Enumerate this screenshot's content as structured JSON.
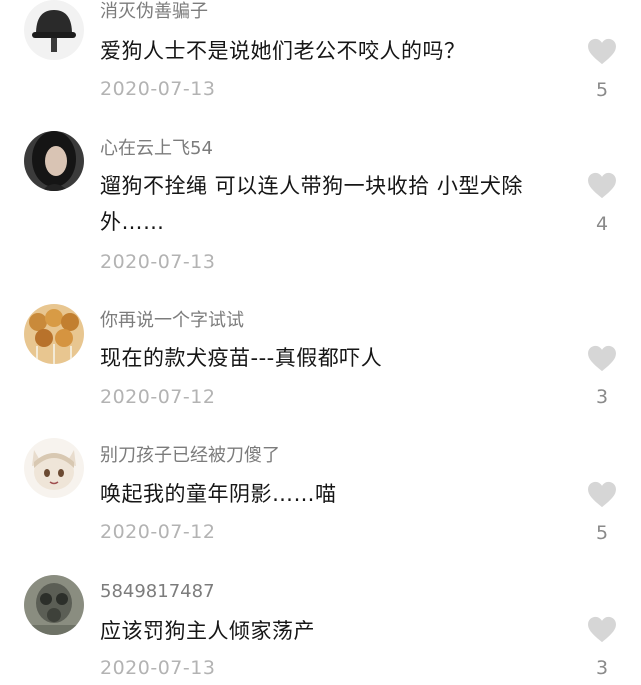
{
  "comments": [
    {
      "username": "消灭伪善骗子",
      "avatar_icon": "helmet-avatar",
      "text": "爱狗人士不是说她们老公不咬人的吗？",
      "date": "2020-07-13",
      "likes": "5"
    },
    {
      "username": "心在云上飞54",
      "avatar_icon": "dark-hair-avatar",
      "text": "遛狗不拴绳 可以连人带狗一块收拾 小型犬除外……",
      "date": "2020-07-13",
      "likes": "4"
    },
    {
      "username": "你再说一个字试试",
      "avatar_icon": "food-skewers-avatar",
      "text": "现在的款犬疫苗---真假都吓人",
      "date": "2020-07-12",
      "likes": "3"
    },
    {
      "username": "别刀孩子已经被刀傻了",
      "avatar_icon": "anime-girl-avatar",
      "text": "唤起我的童年阴影……喵",
      "date": "2020-07-12",
      "likes": "5"
    },
    {
      "username": "5849817487",
      "avatar_icon": "gas-mask-avatar",
      "text": "应该罚狗主人倾家荡产",
      "date": "2020-07-13",
      "likes": "3"
    }
  ],
  "like_icon": "heart-icon",
  "colors": {
    "heart": "#d6d6d6",
    "username": "#7c7c7c",
    "date": "#b3b3b3",
    "text": "#161616"
  }
}
